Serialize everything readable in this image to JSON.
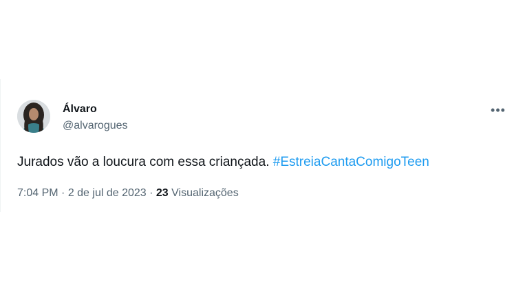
{
  "tweet": {
    "author_name": "Álvaro",
    "author_handle": "@alvarogues",
    "more_icon": "more-horizontal-icon",
    "text_before": "Jurados vão a loucura com essa criançada. ",
    "hashtag": "#EstreiaCantaComigoTeen",
    "time": "7:04 PM",
    "separator1": " · ",
    "date": "2 de jul de 2023",
    "separator2": " · ",
    "views_count": "23",
    "views_label": " Visualizações"
  },
  "colors": {
    "text_primary": "#0f1419",
    "text_secondary": "#536471",
    "link": "#1d9bf0"
  }
}
